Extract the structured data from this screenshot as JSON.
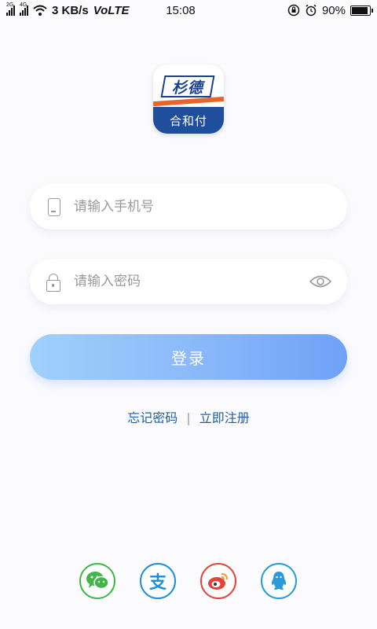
{
  "status_bar": {
    "network_small": "2G",
    "network_small2": "4G",
    "speed": "3 KB/s",
    "volte": "VoLTE",
    "time": "15:08",
    "battery": "90%",
    "battery_level": 0.9
  },
  "logo": {
    "brand": "杉德",
    "sub": "合和付"
  },
  "phone_field": {
    "placeholder": "请输入手机号",
    "value": ""
  },
  "password_field": {
    "placeholder": "请输入密码",
    "value": ""
  },
  "login_button": {
    "label": "登录"
  },
  "links": {
    "forgot": "忘记密码",
    "separator": "|",
    "register": "立即注册"
  },
  "social": [
    "wechat-icon",
    "alipay-icon",
    "weibo-icon",
    "qq-icon"
  ],
  "colors": {
    "accent": "#6ea2f7",
    "link": "#1f5fa8",
    "brand_blue": "#1f4e9c",
    "brand_orange": "#e8642c"
  }
}
